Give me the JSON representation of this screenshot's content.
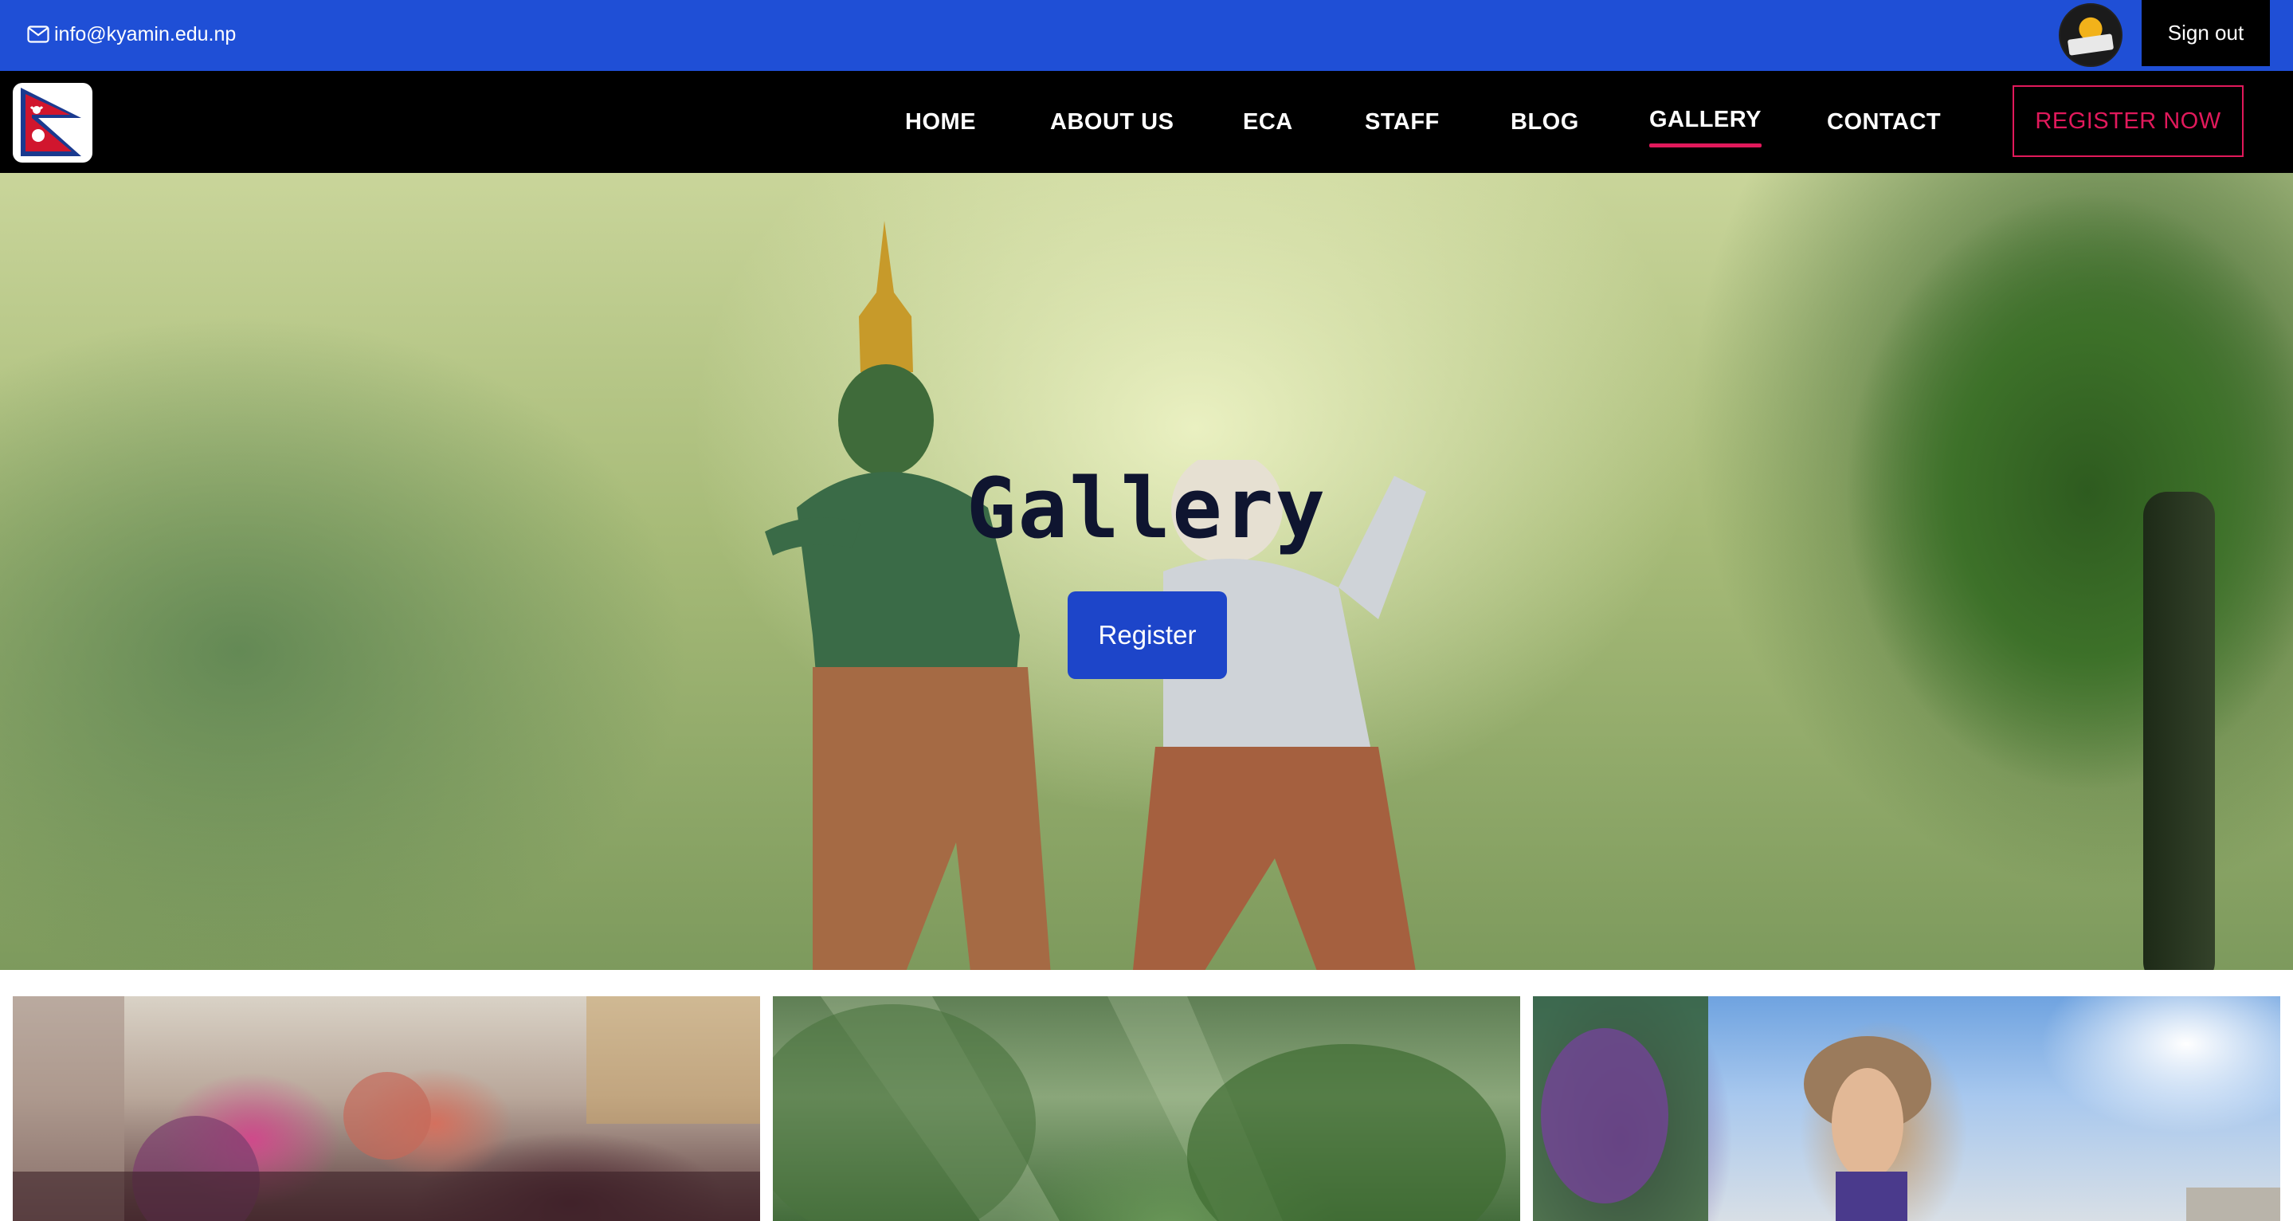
{
  "topbar": {
    "email": "info@kyamin.edu.np",
    "email_icon": "mail-icon",
    "avatar_icon": "khalifa-logo-avatar",
    "sign_out_label": "Sign out",
    "background_color": "#1f4fd6"
  },
  "navbar": {
    "logo_icon": "nepal-flag-icon",
    "links": [
      {
        "label": "HOME"
      },
      {
        "label": "ABOUT US"
      },
      {
        "label": "ECA"
      },
      {
        "label": "STAFF"
      },
      {
        "label": "BLOG"
      },
      {
        "label": "GALLERY",
        "active": true
      },
      {
        "label": "CONTACT"
      }
    ],
    "register_label": "REGISTER NOW",
    "accent_color": "#e1195b"
  },
  "hero": {
    "title": "Gallery",
    "button_label": "Register",
    "button_color": "#1d45c9"
  },
  "gallery": {
    "images": [
      {
        "description_icon": "festival-color-photo"
      },
      {
        "description_icon": "forest-photo"
      },
      {
        "description_icon": "street-parade-photo"
      }
    ]
  }
}
